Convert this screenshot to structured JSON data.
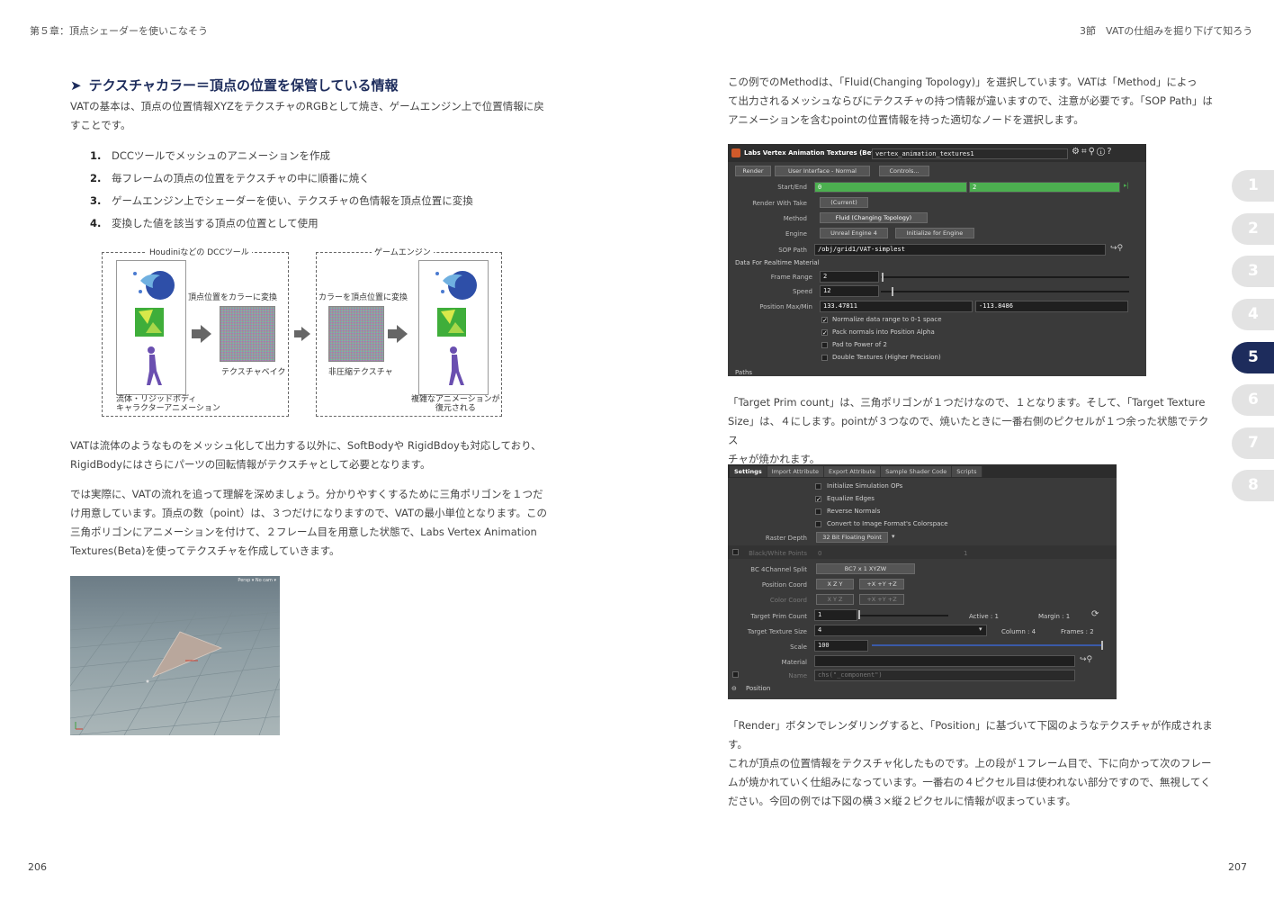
{
  "left_page": {
    "header": "第５章：頂点シェーダーを使いこなそう",
    "page_number": "206",
    "heading": "テクスチャカラー＝頂点の位置を保管している情報",
    "intro_line1": "VATの基本は、頂点の位置情報XYZをテクスチャのRGBとして焼き、ゲームエンジン上で位置情報に戻",
    "intro_line2": "すことです。",
    "steps": [
      {
        "num": "1.",
        "text": "DCCツールでメッシュのアニメーションを作成"
      },
      {
        "num": "2.",
        "text": "毎フレームの頂点の位置をテクスチャの中に順番に焼く"
      },
      {
        "num": "3.",
        "text": "ゲームエンジン上でシェーダーを使い、テクスチャの色情報を頂点位置に変換"
      },
      {
        "num": "4.",
        "text": "変換した値を該当する頂点の位置として使用"
      }
    ],
    "diagram": {
      "left_box_label": "Houdiniなどの DCCツール",
      "right_box_label": "ゲームエンジン",
      "to_color_label": "頂点位置をカラーに変換",
      "texture_bake_label": "テクスチャベイク",
      "to_vertex_label": "カラーを頂点位置に変換",
      "uncompressed_label": "非圧縮テクスチャ",
      "source_caption_line1": "流体・リジッドボディ",
      "source_caption_line2": "キャラクターアニメーション",
      "result_caption_line1": "複雑なアニメーションが",
      "result_caption_line2": "復元される"
    },
    "para2_line1": "VATは流体のようなものをメッシュ化して出力する以外に、SoftBodyや RigidBdoyも対応しており、",
    "para2_line2": "RigidBodyにはさらにパーツの回転情報がテクスチャとして必要となります。",
    "para3_lines": [
      "では実際に、VATの流れを追って理解を深めましょう。分かりやすくするために三角ポリゴンを１つだ",
      "け用意しています。頂点の数（point）は、３つだけになりますので、VATの最小単位となります。この",
      "三角ポリゴンにアニメーションを付けて、２フレーム目を用意した状態で、Labs Vertex Animation",
      "Textures(Beta)を使ってテクスチャを作成していきます。"
    ],
    "viewport_label": "Persp ▾  No cam ▾"
  },
  "right_page": {
    "header": "3節　VATの仕組みを掘り下げて知ろう",
    "page_number": "207",
    "para1_lines": [
      "この例でのMethodは、「Fluid(Changing Topology)」を選択しています。VATは「Method」によっ",
      "て出力されるメッシュならびにテクスチャの持つ情報が違いますので、注意が必要です。「SOP Path」は",
      "アニメーションを含むpointの位置情報を持った適切なノードを選択します。"
    ],
    "para2_lines": [
      "「Target Prim count」は、三角ポリゴンが１つだけなので、１となります。そして、「Target Texture",
      "Size」は、４にします。pointが３つなので、焼いたときに一番右側のピクセルが１つ余った状態でテクス",
      "チャが焼かれます。"
    ],
    "para3_lines": [
      "「Render」ボタンでレンダリングすると、「Position」に基づいて下図のようなテクスチャが作成されます。",
      "これが頂点の位置情報をテクスチャ化したものです。上の段が１フレーム目で、下に向かって次のフレー",
      "ムが焼かれていく仕組みになっています。一番右の４ピクセル目は使われない部分ですので、無視してく",
      "ださい。今回の例では下図の横３×縦２ピクセルに情報が収まっています。"
    ],
    "panel1": {
      "title": "Labs Vertex Animation Textures (Beta)",
      "node_name": "vertex_animation_textures1",
      "render_button": "Render",
      "ui_mode": "User Interface - Normal",
      "controls_button": "Controls...",
      "start_end_label": "Start/End",
      "start_value": "0",
      "end_value": "2",
      "render_with_take_label": "Render With Take",
      "render_with_take_value": "(Current)",
      "method_label": "Method",
      "method_value": "Fluid (Changing Topology)",
      "engine_label": "Engine",
      "engine_value": "Unreal Engine 4",
      "initialize_button": "Initialize for Engine",
      "sop_path_label": "SOP Path",
      "sop_path_value": "/obj/grid1/VAT-simplest",
      "data_section": "Data For Realtime Material",
      "frame_range_label": "Frame Range",
      "frame_range_value": "2",
      "speed_label": "Speed",
      "speed_value": "12",
      "position_label": "Position Max/Min",
      "position_max": "133.47811",
      "position_min": "-113.8486",
      "checks": [
        {
          "label": "Normalize data range to 0-1 space",
          "checked": true
        },
        {
          "label": "Pack normals into Position Alpha",
          "checked": true
        },
        {
          "label": "Pad to Power of 2",
          "checked": false
        },
        {
          "label": "Double Textures (Higher Precision)",
          "checked": false
        }
      ],
      "paths_section": "Paths"
    },
    "panel2": {
      "tabs": [
        "Settings",
        "Import Attribute",
        "Export Attribute",
        "Sample Shader Code",
        "Scripts"
      ],
      "checks": [
        {
          "label": "Initialize Simulation OPs",
          "checked": false
        },
        {
          "label": "Equalize Edges",
          "checked": true
        },
        {
          "label": "Reverse Normals",
          "checked": false
        },
        {
          "label": "Convert to Image Format's Colorspace",
          "checked": false
        }
      ],
      "raster_depth_label": "Raster Depth",
      "raster_depth_value": "32 Bit Floating Point",
      "bw_points_label": "Black/White Points",
      "bw_points_value1": "0",
      "bw_points_value2": "1",
      "bc4_label": "BC 4Channel Split",
      "bc4_value": "BC7 x 1 XYZW",
      "position_coord_label": "Position Coord",
      "position_coord_value1": "X Z Y",
      "position_coord_value2": "+X +Y +Z",
      "color_coord_label": "Color Coord",
      "color_coord_value1": "X Y Z",
      "color_coord_value2": "+X +Y +Z",
      "target_prim_label": "Target Prim Count",
      "target_prim_value": "1",
      "active_label": "Active : 1",
      "margin_label": "Margin : 1",
      "target_tex_label": "Target Texture Size",
      "target_tex_value": "4",
      "column_label": "Column : 4",
      "frames_label": "Frames : 2",
      "scale_label": "Scale",
      "scale_value": "100",
      "material_label": "Material",
      "name_label": "Name",
      "name_value": "chs(\"_component\")",
      "position_section": "Position"
    }
  },
  "chapter_tabs": [
    "1",
    "2",
    "3",
    "4",
    "5",
    "6",
    "7",
    "8"
  ],
  "active_chapter": "5",
  "colors": {
    "heading_navy": "#1d2c5c",
    "tab_grey": "#e3e3e3",
    "houdini_bg": "#3a3a3a",
    "timeline_green": "#4caf50"
  }
}
